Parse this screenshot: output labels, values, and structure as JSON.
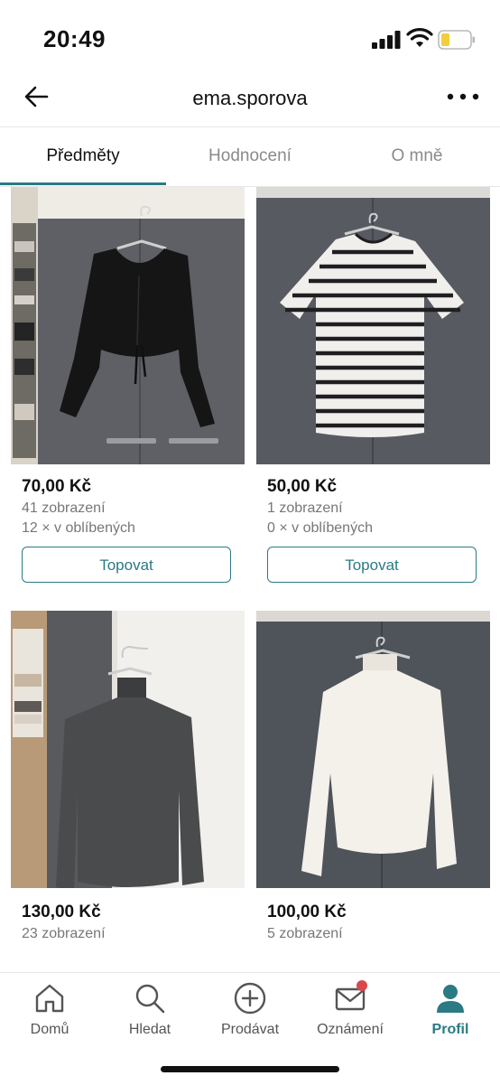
{
  "status": {
    "time": "20:49"
  },
  "header": {
    "title": "ema.sporova"
  },
  "tabs": [
    {
      "label": "Předměty"
    },
    {
      "label": "Hodnocení"
    },
    {
      "label": "O mně"
    }
  ],
  "items": [
    {
      "price": "70,00 Kč",
      "views": "41 zobrazení",
      "favs": "12 × v oblíbených",
      "button": "Topovat"
    },
    {
      "price": "50,00 Kč",
      "views": "1 zobrazení",
      "favs": "0 × v oblíbených",
      "button": "Topovat"
    },
    {
      "price": "130,00 Kč",
      "views": "23 zobrazení"
    },
    {
      "price": "100,00 Kč",
      "views": "5 zobrazení"
    }
  ],
  "nav": [
    {
      "label": "Domů",
      "icon": "home-icon"
    },
    {
      "label": "Hledat",
      "icon": "search-icon"
    },
    {
      "label": "Prodávat",
      "icon": "plus-circle-icon"
    },
    {
      "label": "Oznámení",
      "icon": "mail-icon"
    },
    {
      "label": "Profil",
      "icon": "profile-icon"
    }
  ],
  "colors": {
    "accent": "#2b7a84",
    "badge": "#d9484c"
  }
}
